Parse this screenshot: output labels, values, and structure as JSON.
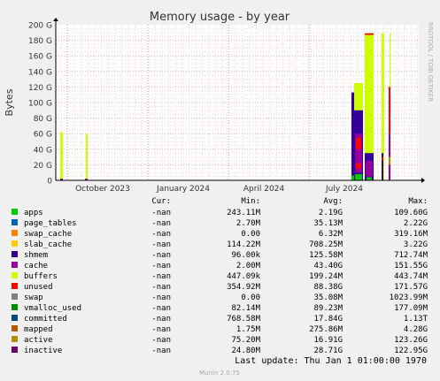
{
  "chart_data": {
    "type": "area",
    "title": "Memory usage - by year",
    "ylabel": "Bytes",
    "side_label": "RRDTOOL / TOBI OETIKER",
    "footer": "Munin 2.0.75",
    "ylim": [
      0,
      200
    ],
    "y_unit": "G",
    "y_ticks": [
      "0",
      "20 G",
      "40 G",
      "60 G",
      "80 G",
      "100 G",
      "120 G",
      "140 G",
      "160 G",
      "180 G",
      "200 G"
    ],
    "x_ticks": [
      "October 2023",
      "January 2024",
      "April 2024",
      "July 2024"
    ],
    "grid": true,
    "legend_headers": {
      "cur": "Cur:",
      "min": "Min:",
      "avg": "Avg:",
      "max": "Max:"
    },
    "series": [
      {
        "name": "apps",
        "color": "#00cc00",
        "cur": "-nan",
        "min": "243.11M",
        "avg": "2.19G",
        "max": "109.60G"
      },
      {
        "name": "page_tables",
        "color": "#0066b3",
        "cur": "-nan",
        "min": "2.70M",
        "avg": "35.13M",
        "max": "2.22G"
      },
      {
        "name": "swap_cache",
        "color": "#ff8000",
        "cur": "-nan",
        "min": "0.00",
        "avg": "6.32M",
        "max": "319.16M"
      },
      {
        "name": "slab_cache",
        "color": "#ffcc00",
        "cur": "-nan",
        "min": "114.22M",
        "avg": "708.25M",
        "max": "3.22G"
      },
      {
        "name": "shmem",
        "color": "#330099",
        "cur": "-nan",
        "min": "96.00k",
        "avg": "125.58M",
        "max": "712.74M"
      },
      {
        "name": "cache",
        "color": "#990099",
        "cur": "-nan",
        "min": "2.00M",
        "avg": "43.40G",
        "max": "151.55G"
      },
      {
        "name": "buffers",
        "color": "#ccff00",
        "cur": "-nan",
        "min": "447.09k",
        "avg": "199.24M",
        "max": "443.74M"
      },
      {
        "name": "unused",
        "color": "#ff0000",
        "cur": "-nan",
        "min": "354.92M",
        "avg": "88.38G",
        "max": "171.57G"
      },
      {
        "name": "swap",
        "color": "#808080",
        "cur": "-nan",
        "min": "0.00",
        "avg": "35.08M",
        "max": "1023.99M"
      },
      {
        "name": "vmalloc_used",
        "color": "#008f00",
        "cur": "-nan",
        "min": "82.14M",
        "avg": "89.23M",
        "max": "177.09M"
      },
      {
        "name": "committed",
        "color": "#00487d",
        "cur": "-nan",
        "min": "768.58M",
        "avg": "17.84G",
        "max": "1.13T"
      },
      {
        "name": "mapped",
        "color": "#b35a00",
        "cur": "-nan",
        "min": "1.75M",
        "avg": "275.86M",
        "max": "4.28G"
      },
      {
        "name": "active",
        "color": "#b38f00",
        "cur": "-nan",
        "min": "75.20M",
        "avg": "16.91G",
        "max": "123.26G"
      },
      {
        "name": "inactive",
        "color": "#6b006b",
        "cur": "-nan",
        "min": "24.80M",
        "avg": "28.71G",
        "max": "122.95G"
      }
    ],
    "last_update": "Last update: Thu Jan  1 01:00:00 1970"
  }
}
